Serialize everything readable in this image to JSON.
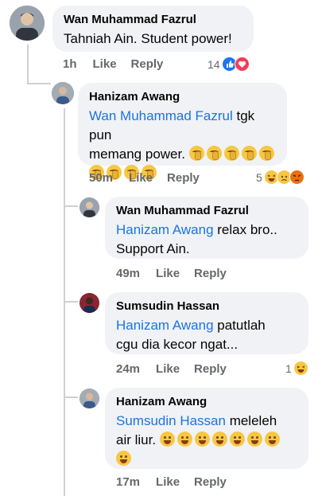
{
  "colors": {
    "mention": "#1b74e4",
    "bubble": "#f0f2f5",
    "meta": "#65676b"
  },
  "comments": [
    {
      "author": "Wan Muhammad Fazrul",
      "text": "Tahniah Ain. Student power!",
      "time": "1h",
      "like": "Like",
      "reply": "Reply",
      "reaction_count": "14",
      "reactions": [
        "like-icon",
        "love-icon"
      ]
    },
    {
      "author": "Hanizam Awang",
      "mention": "Wan Muhammad Fazrul",
      "text_1": " tgk pun",
      "text_2": "memang power.",
      "emoji": "shushing-face-icon",
      "time": "50m",
      "like": "Like",
      "reply": "Reply",
      "reaction_count": "5",
      "reactions": [
        "haha-icon",
        "sad-icon",
        "angry-icon"
      ]
    },
    {
      "author": "Wan Muhammad Fazrul",
      "mention": "Hanizam Awang",
      "text_1": " relax bro..",
      "text_2": "Support Ain.",
      "time": "49m",
      "like": "Like",
      "reply": "Reply"
    },
    {
      "author": "Sumsudin Hassan",
      "mention": "Hanizam Awang",
      "text_1": " patutlah",
      "text_2": "cgu dia kecor ngat...",
      "time": "24m",
      "like": "Like",
      "reply": "Reply",
      "reaction_count": "1",
      "reactions": [
        "haha-icon"
      ]
    },
    {
      "author": "Hanizam Awang",
      "mention": "Sumsudin Hassan",
      "text_1": " meleleh",
      "text_2": "air liur.",
      "emoji": "rolling-laughing-icon",
      "time": "17m",
      "like": "Like",
      "reply": "Reply"
    }
  ]
}
